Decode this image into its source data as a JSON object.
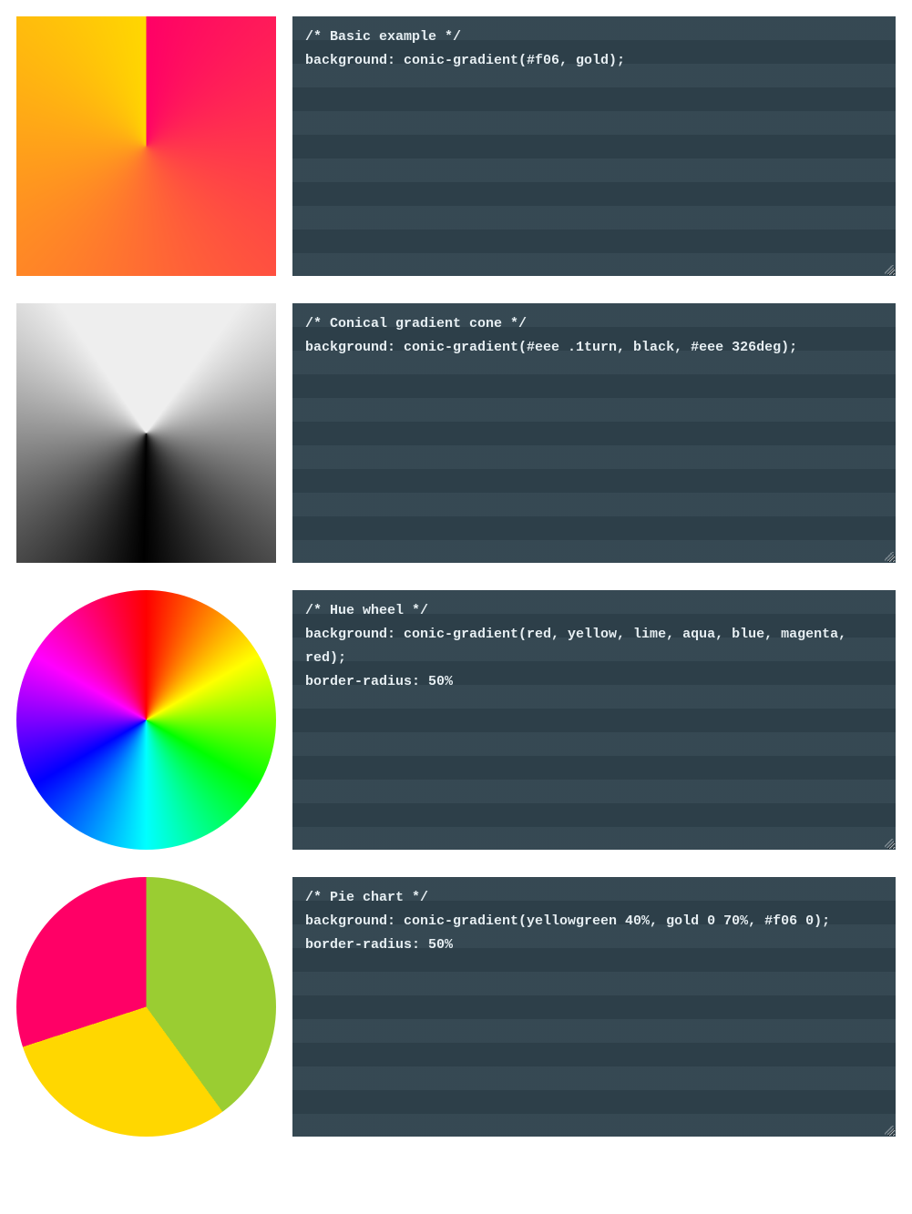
{
  "examples": [
    {
      "id": "basic",
      "code": "/* Basic example */\nbackground: conic-gradient(#f06, gold);"
    },
    {
      "id": "cone",
      "code": "/* Conical gradient cone */\nbackground: conic-gradient(#eee .1turn, black, #eee 326deg);"
    },
    {
      "id": "hue",
      "code": "/* Hue wheel */\nbackground: conic-gradient(red, yellow, lime, aqua, blue, magenta, red);\nborder-radius: 50%"
    },
    {
      "id": "pie",
      "code": "/* Pie chart */\nbackground: conic-gradient(yellowgreen 40%, gold 0 70%, #f06 0);\nborder-radius: 50%"
    }
  ]
}
